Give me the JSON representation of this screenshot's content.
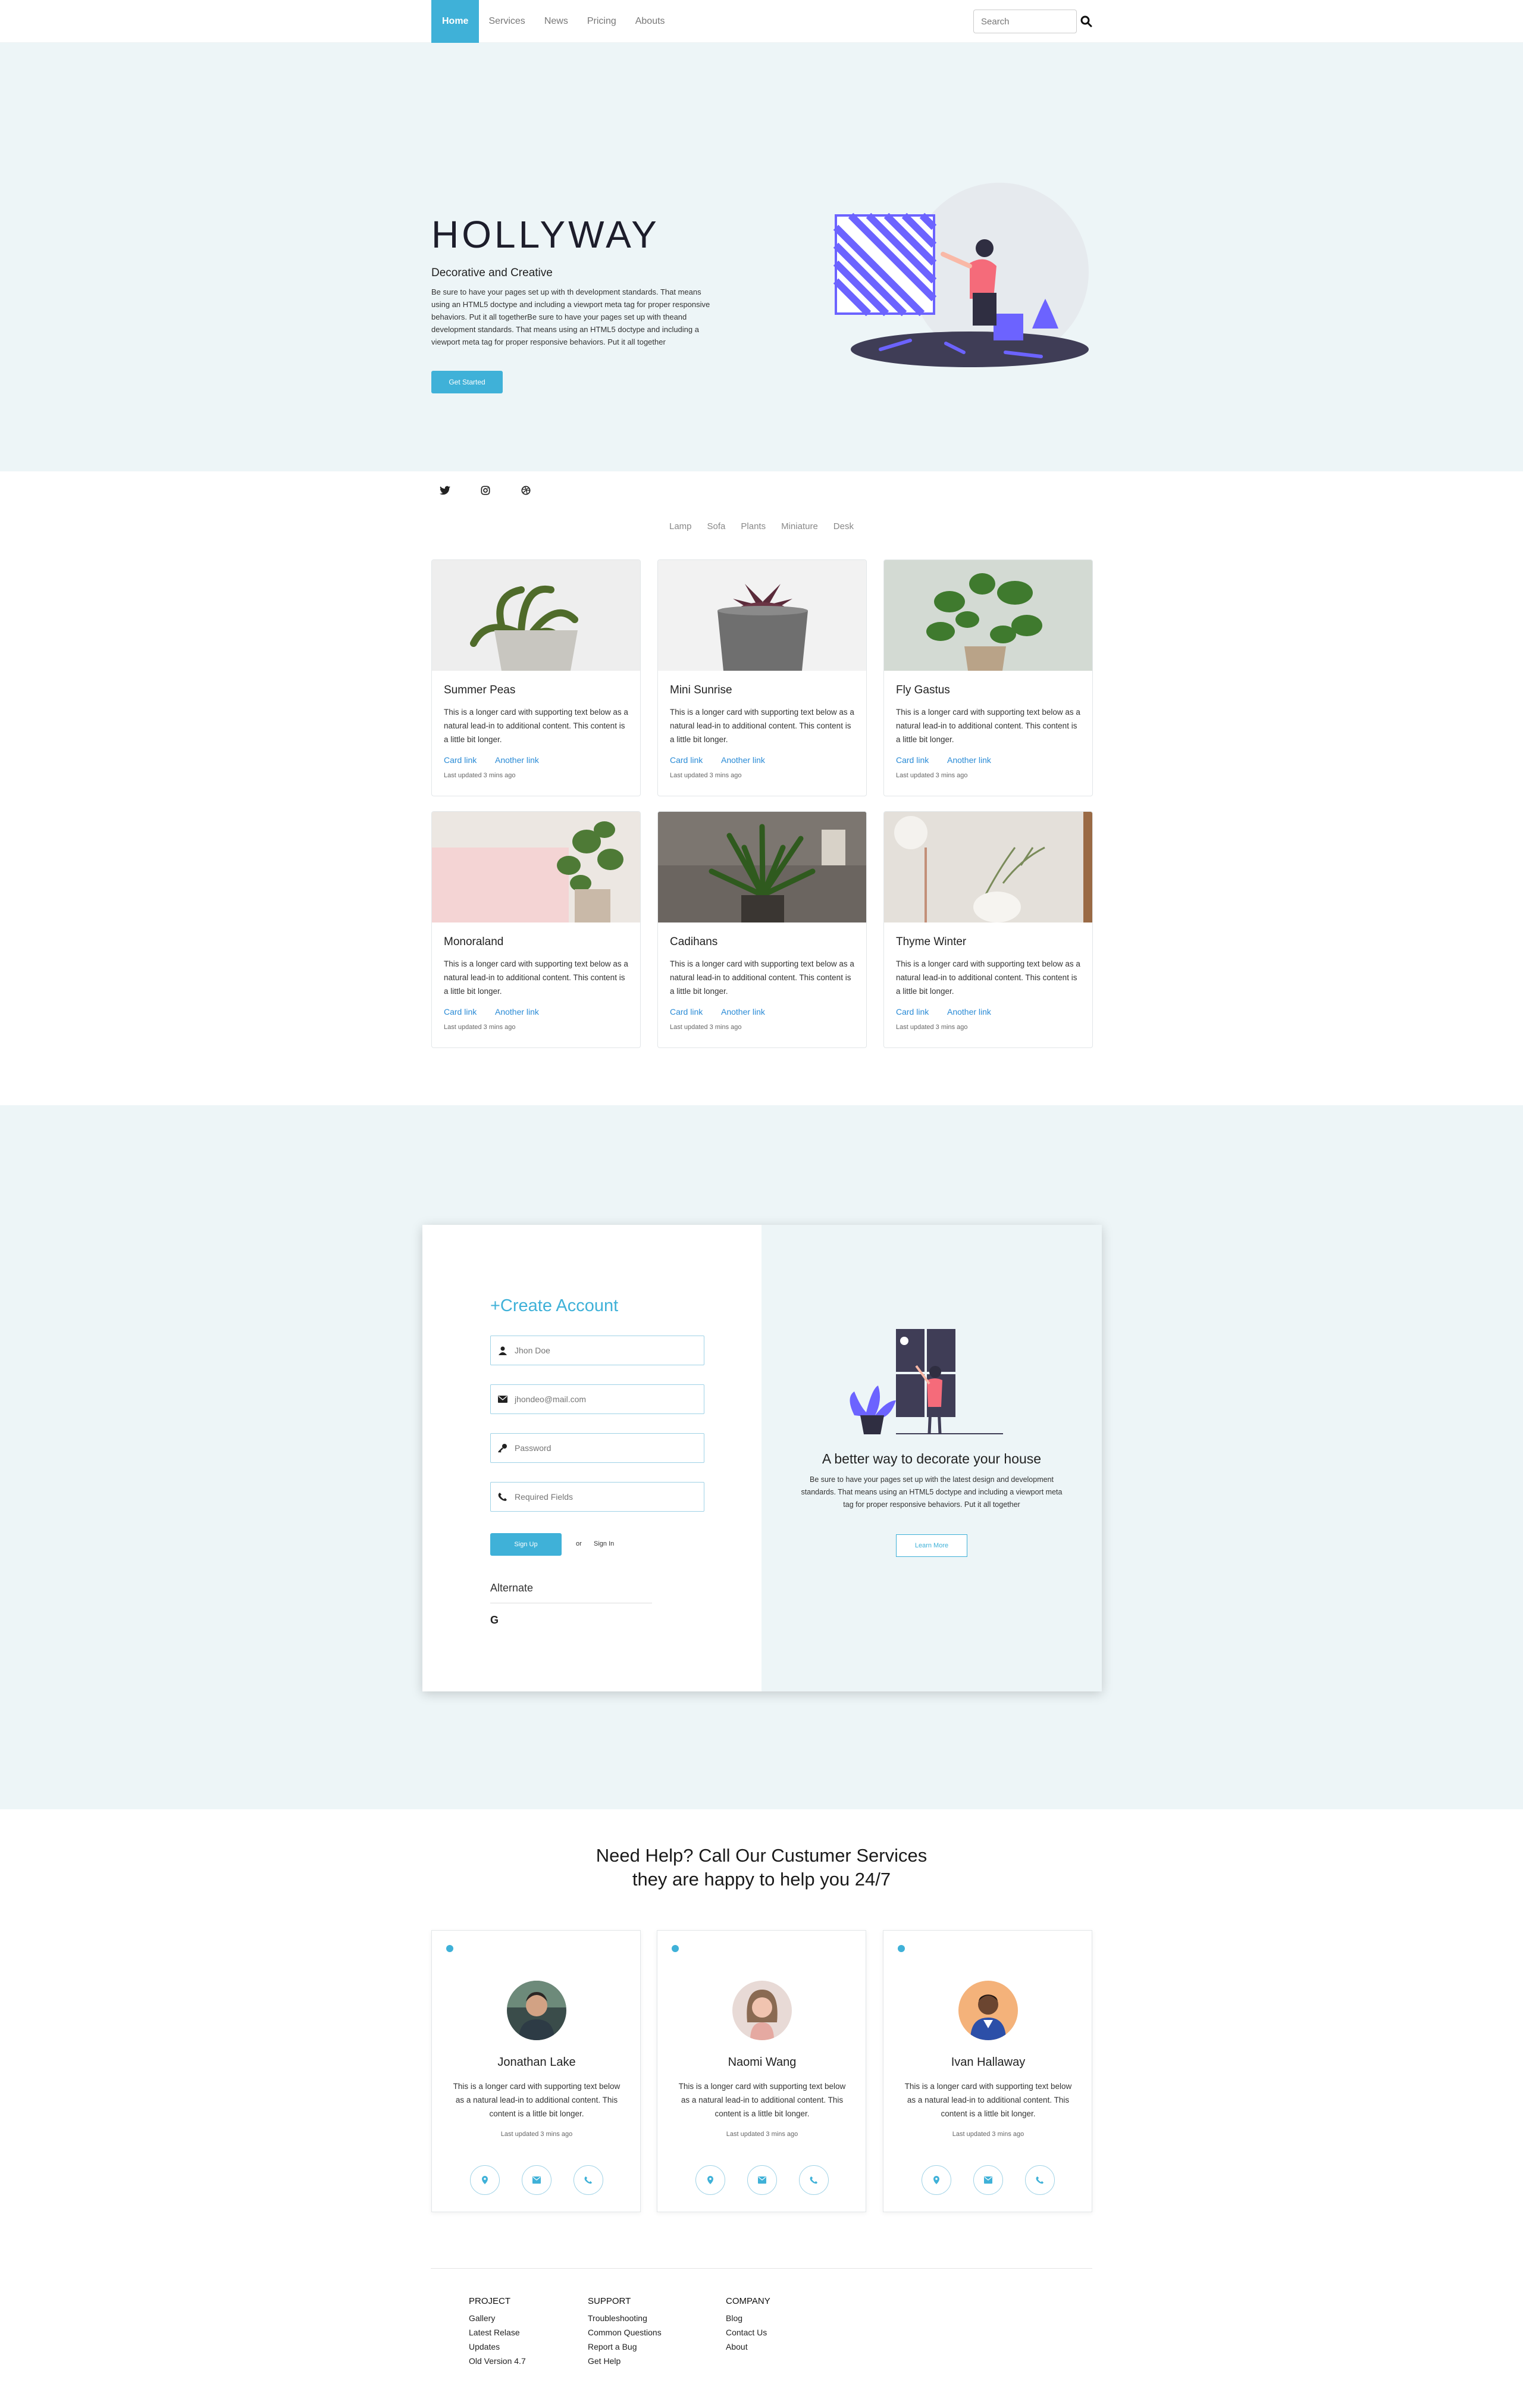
{
  "nav": {
    "items": [
      "Home",
      "Services",
      "News",
      "Pricing",
      "Abouts"
    ],
    "search_placeholder": "Search"
  },
  "hero": {
    "title": "HOLLYWAY",
    "subtitle": "Decorative and Creative",
    "text": "Be sure to have your pages set up with th development standards. That means using an HTML5 doctype and including a viewport meta tag for proper responsive behaviors. Put it all togetherBe sure to have your pages set up with theand development standards. That means using an HTML5 doctype and including a viewport meta tag for proper responsive behaviors. Put it all together",
    "button": "Get Started"
  },
  "social": [
    "twitter-icon",
    "instagram-icon",
    "dribbble-icon"
  ],
  "filters": [
    "Lamp",
    "Sofa",
    "Plants",
    "Miniature",
    "Desk"
  ],
  "products": [
    {
      "title": "Summer Peas",
      "text": "This is a longer card with supporting text below as a natural lead-in to additional content. This content is a little bit longer.",
      "link1": "Card link",
      "link2": "Another link",
      "updated": "Last updated 3 mins ago"
    },
    {
      "title": "Mini Sunrise",
      "text": "This is a longer card with supporting text below as a natural lead-in to additional content. This content is a little bit longer.",
      "link1": "Card link",
      "link2": "Another link",
      "updated": "Last updated 3 mins ago"
    },
    {
      "title": "Fly Gastus",
      "text": "This is a longer card with supporting text below as a natural lead-in to additional content. This content is a little bit longer.",
      "link1": "Card link",
      "link2": "Another link",
      "updated": "Last updated 3 mins ago"
    },
    {
      "title": "Monoraland",
      "text": "This is a longer card with supporting text below as a natural lead-in to additional content. This content is a little bit longer.",
      "link1": "Card link",
      "link2": "Another link",
      "updated": "Last updated 3 mins ago"
    },
    {
      "title": "Cadihans",
      "text": "This is a longer card with supporting text below as a natural lead-in to additional content. This content is a little bit longer.",
      "link1": "Card link",
      "link2": "Another link",
      "updated": "Last updated 3 mins ago"
    },
    {
      "title": "Thyme Winter",
      "text": "This is a longer card with supporting text below as a natural lead-in to additional content. This content is a little bit longer.",
      "link1": "Card link",
      "link2": "Another link",
      "updated": "Last updated 3 mins ago"
    }
  ],
  "signup": {
    "title": "+Create Account",
    "name_placeholder": "Jhon Doe",
    "email_placeholder": "jhondeo@mail.com",
    "password_placeholder": "Password",
    "required_placeholder": "Required Fields",
    "button": "Sign Up",
    "or": "or",
    "signin": "Sign In",
    "alternate": "Alternate",
    "google": "G"
  },
  "promo": {
    "title": "A better way to decorate your house",
    "text": "Be sure to have your pages set up with the latest design and development standards. That means using an HTML5 doctype and including a viewport meta tag for proper responsive behaviors. Put it all together",
    "button": "Learn More"
  },
  "help": {
    "line1": "Need Help? Call Our Custumer Services",
    "line2": "they are happy to help you 24/7"
  },
  "team": [
    {
      "name": "Jonathan Lake",
      "text": "This is a longer card with supporting text below as a natural lead-in to additional content. This content is a little bit longer.",
      "updated": "Last updated 3 mins ago"
    },
    {
      "name": "Naomi Wang",
      "text": "This is a longer card with supporting text below as a natural lead-in to additional content. This content is a little bit longer.",
      "updated": "Last updated 3 mins ago"
    },
    {
      "name": "Ivan Hallaway",
      "text": "This is a longer card with supporting text below as a natural lead-in to additional content. This content is a little bit longer.",
      "updated": "Last updated 3 mins ago"
    }
  ],
  "footer": {
    "project": {
      "heading": "PROJECT",
      "links": [
        "Gallery",
        "Latest Relase",
        "Updates",
        "Old Version 4.7"
      ]
    },
    "support": {
      "heading": "SUPPORT",
      "links": [
        "Troubleshooting",
        "Common Questions",
        "Report a Bug",
        "Get Help"
      ]
    },
    "company": {
      "heading": "COMPANY",
      "links": [
        "Blog",
        "Contact Us",
        "About"
      ]
    }
  },
  "colors": {
    "accent": "#3fb1d8",
    "hero_bg": "#edf5f7",
    "illustration_purple": "#6c63ff",
    "link": "#2a8bd6"
  }
}
